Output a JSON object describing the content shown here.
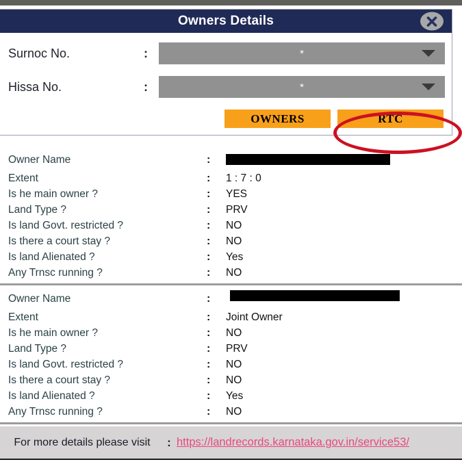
{
  "dialog": {
    "title": "Owners Details",
    "close_icon": "close-x-icon",
    "fields": [
      {
        "label": "Surnoc No.",
        "colon": ":",
        "value": "*",
        "arrow_icon": "chevron-down-icon"
      },
      {
        "label": "Hissa No.",
        "colon": ":",
        "value": "*",
        "arrow_icon": "chevron-down-icon"
      }
    ],
    "buttons": {
      "owners": "OWNERS",
      "rtc": "RTC"
    }
  },
  "annotation": {
    "shape": "ellipse",
    "color": "#cc1122",
    "target": "RTC"
  },
  "colors": {
    "header_navy": "#1f2a56",
    "button_orange": "#f9a01b",
    "select_gray": "#919191",
    "label_slate": "#2b4146",
    "link_pink": "#e8497f",
    "footer_gray": "#d6d4d4",
    "annotation_red": "#cc1122"
  },
  "owners": [
    {
      "rows": [
        {
          "label": "Owner Name",
          "colon": ":",
          "value": "",
          "redacted": true
        },
        {
          "label": "Extent",
          "colon": ":",
          "value": "1 : 7 : 0",
          "redacted": false
        },
        {
          "label": "Is he main owner ?",
          "colon": ":",
          "value": "YES",
          "redacted": false
        },
        {
          "label": "Land Type ?",
          "colon": ":",
          "value": "PRV",
          "redacted": false
        },
        {
          "label": "Is land Govt. restricted ?",
          "colon": ":",
          "value": "NO",
          "redacted": false
        },
        {
          "label": "Is there a court stay ?",
          "colon": ":",
          "value": "NO",
          "redacted": false
        },
        {
          "label": "Is land Alienated ?",
          "colon": ":",
          "value": "Yes",
          "redacted": false
        },
        {
          "label": "Any Trnsc running ?",
          "colon": ":",
          "value": "NO",
          "redacted": false
        }
      ]
    },
    {
      "rows": [
        {
          "label": "Owner Name",
          "colon": ":",
          "value": "",
          "redacted": true
        },
        {
          "label": "Extent",
          "colon": ":",
          "value": "Joint Owner",
          "redacted": false
        },
        {
          "label": "Is he main owner ?",
          "colon": ":",
          "value": "NO",
          "redacted": false
        },
        {
          "label": "Land Type ?",
          "colon": ":",
          "value": "PRV",
          "redacted": false
        },
        {
          "label": "Is land Govt. restricted ?",
          "colon": ":",
          "value": "NO",
          "redacted": false
        },
        {
          "label": "Is there a court stay ?",
          "colon": ":",
          "value": "NO",
          "redacted": false
        },
        {
          "label": "Is land Alienated ?",
          "colon": ":",
          "value": "Yes",
          "redacted": false
        },
        {
          "label": "Any Trnsc running ?",
          "colon": ":",
          "value": "NO",
          "redacted": false
        }
      ]
    }
  ],
  "footer": {
    "text": "For more details please visit",
    "colon": ":",
    "link": "https://landrecords.karnataka.gov.in/service53/"
  }
}
